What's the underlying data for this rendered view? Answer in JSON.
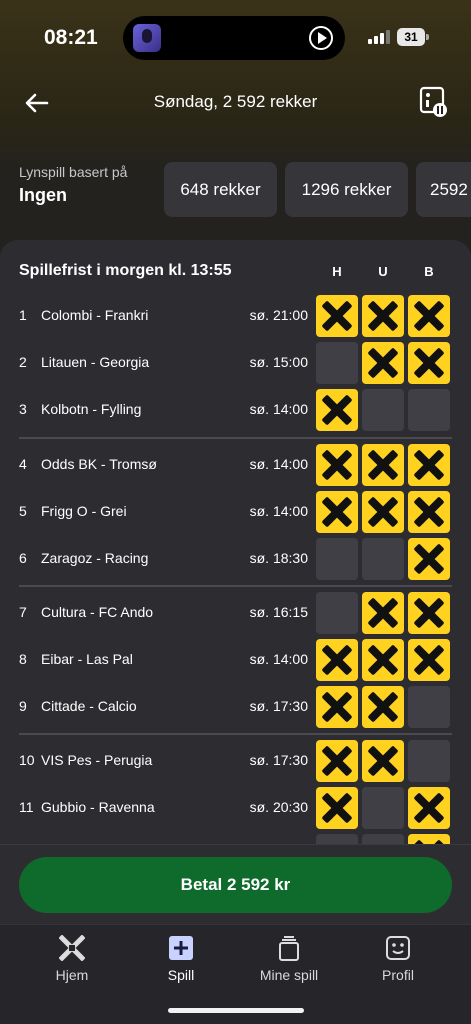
{
  "status": {
    "time": "08:21",
    "battery": "31"
  },
  "header": {
    "title": "Søndag, 2 592 rekker"
  },
  "lynspill": {
    "label": "Lynspill basert på",
    "value": "Ingen",
    "options": [
      "648 rekker",
      "1296 rekker",
      "2592"
    ]
  },
  "coupon": {
    "deadline": "Spillefrist i morgen kl. 13:55",
    "columns": [
      "H",
      "U",
      "B"
    ],
    "rows": [
      {
        "num": "1",
        "match": "Colombi - Frankri",
        "time": "sø. 21:00",
        "picks": [
          true,
          true,
          true
        ]
      },
      {
        "num": "2",
        "match": "Litauen - Georgia",
        "time": "sø. 15:00",
        "picks": [
          false,
          true,
          true
        ]
      },
      {
        "num": "3",
        "match": "Kolbotn - Fylling",
        "time": "sø. 14:00",
        "picks": [
          true,
          false,
          false
        ]
      },
      {
        "num": "4",
        "match": "Odds BK - Tromsø",
        "time": "sø. 14:00",
        "picks": [
          true,
          true,
          true
        ]
      },
      {
        "num": "5",
        "match": "Frigg O - Grei",
        "time": "sø. 14:00",
        "picks": [
          true,
          true,
          true
        ]
      },
      {
        "num": "6",
        "match": "Zaragoz - Racing",
        "time": "sø. 18:30",
        "picks": [
          false,
          false,
          true
        ]
      },
      {
        "num": "7",
        "match": "Cultura - FC Ando",
        "time": "sø. 16:15",
        "picks": [
          false,
          true,
          true
        ]
      },
      {
        "num": "8",
        "match": "Eibar - Las Pal",
        "time": "sø. 14:00",
        "picks": [
          true,
          true,
          true
        ]
      },
      {
        "num": "9",
        "match": "Cittade - Calcio",
        "time": "sø. 17:30",
        "picks": [
          true,
          true,
          false
        ]
      },
      {
        "num": "10",
        "match": "VIS Pes - Perugia",
        "time": "sø. 17:30",
        "picks": [
          true,
          true,
          false
        ]
      },
      {
        "num": "11",
        "match": "Gubbio - Ravenna",
        "time": "sø. 20:30",
        "picks": [
          true,
          false,
          true
        ]
      },
      {
        "num": "",
        "match": "",
        "time": "",
        "picks": [
          false,
          false,
          true
        ]
      }
    ]
  },
  "pay": {
    "label": "Betal 2 592 kr"
  },
  "nav": {
    "items": [
      "Hjem",
      "Spill",
      "Mine spill",
      "Profil"
    ],
    "active": 1
  },
  "colors": {
    "accent_yellow": "#ffd21f",
    "pay_green": "#0f6b2c",
    "panel": "#2d2d31",
    "empty_cell": "#3f3f45"
  },
  "icons": [
    "back-arrow-icon",
    "stats-icon",
    "home-icon",
    "plus-icon",
    "tickets-icon",
    "profile-icon",
    "play-icon",
    "signal-icon",
    "battery-icon"
  ]
}
